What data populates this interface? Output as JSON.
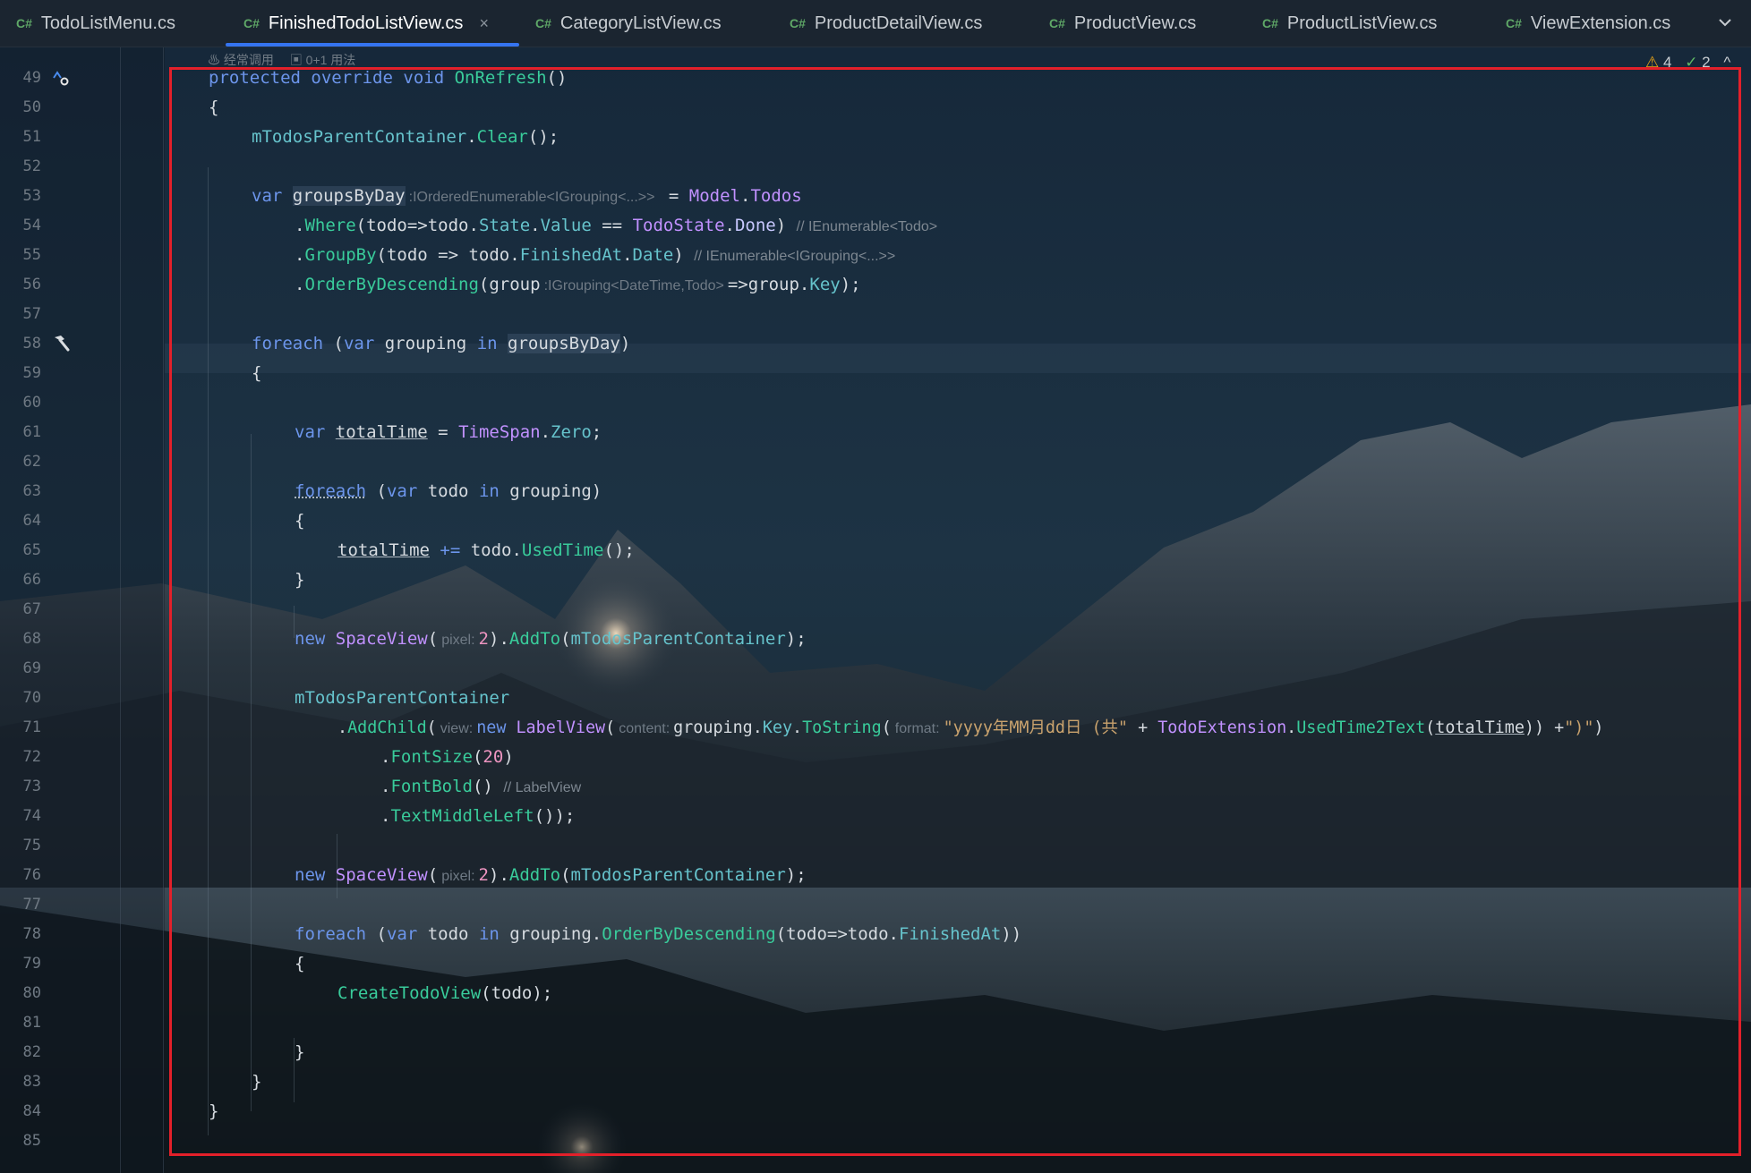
{
  "tabs": [
    {
      "icon": "csharp-file-icon",
      "lang": "C#",
      "label": "TodoListMenu.cs",
      "active": false
    },
    {
      "icon": "csharp-file-icon",
      "lang": "C#",
      "label": "FinishedTodoListView.cs",
      "active": true
    },
    {
      "icon": "csharp-file-icon",
      "lang": "C#",
      "label": "CategoryListView.cs",
      "active": false
    },
    {
      "icon": "csharp-file-icon",
      "lang": "C#",
      "label": "ProductDetailView.cs",
      "active": false
    },
    {
      "icon": "csharp-file-icon",
      "lang": "C#",
      "label": "ProductView.cs",
      "active": false
    },
    {
      "icon": "csharp-file-icon",
      "lang": "C#",
      "label": "ProductListView.cs",
      "active": false
    },
    {
      "icon": "csharp-file-icon",
      "lang": "C#",
      "label": "ViewExtension.cs",
      "active": false
    }
  ],
  "tab_close": "×",
  "inlay_usages": {
    "frequent": "经常调用",
    "usages": "0+1 用法"
  },
  "inspection": {
    "warnings": "4",
    "ok": "2"
  },
  "gutter": {
    "line_numbers": [
      "49",
      "50",
      "51",
      "52",
      "53",
      "54",
      "55",
      "56",
      "57",
      "58",
      "59",
      "60",
      "61",
      "62",
      "63",
      "64",
      "65",
      "66",
      "67",
      "68",
      "69",
      "70",
      "71",
      "72",
      "73",
      "74",
      "75",
      "76",
      "77",
      "78",
      "79",
      "80",
      "81",
      "82",
      "83",
      "84",
      "85"
    ]
  },
  "code": {
    "l49": {
      "protected": "protected",
      "override": "override",
      "void": "void",
      "name": "OnRefresh",
      "tail": "()"
    },
    "l50": "{",
    "l51": {
      "field": "mTodosParentContainer",
      "dot": ".",
      "method": "Clear",
      "tail": "();"
    },
    "l53": {
      "var": "var",
      "name": "groupsByDay",
      "hint": ":IOrderedEnumerable<IGrouping<...>>",
      "eq": " = ",
      "model": "Model",
      "dot": ".",
      "prop": "Todos"
    },
    "l54": {
      "dot": ".",
      "method": "Where",
      "p1": "(todo=>todo.",
      "state": "State",
      "dot2": ".",
      "value": "Value",
      "op": " == ",
      "type": "TodoState",
      "dot3": ".",
      "done": "Done",
      "close": ")",
      "comment": "// IEnumerable<Todo>"
    },
    "l55": {
      "dot": ".",
      "method": "GroupBy",
      "p1": "(todo => todo.",
      "fin": "FinishedAt",
      "dot2": ".",
      "date": "Date",
      "close": ")",
      "comment": "// IEnumerable<IGrouping<...>>"
    },
    "l56": {
      "dot": ".",
      "method": "OrderByDescending",
      "p1": "(group",
      "hint": ":IGrouping<DateTime,Todo>",
      "p2": "=>group.",
      "key": "Key",
      "tail": ");"
    },
    "l58": {
      "foreach": "foreach",
      "open": " (",
      "var": "var",
      "mid": " grouping ",
      "in": "in",
      "sp": " ",
      "coll": "groupsByDay",
      "close": ")"
    },
    "l59": "{",
    "l61": {
      "var": "var",
      "name": "totalTime",
      "eq": " = ",
      "type": "TimeSpan",
      "dot": ".",
      "zero": "Zero",
      "semi": ";"
    },
    "l63": {
      "foreach": "foreach",
      "open": " (",
      "var": "var",
      "mid": " todo ",
      "in": "in",
      "rest": " grouping)"
    },
    "l64": "{",
    "l65": {
      "name": "totalTime",
      "op": " += ",
      "obj": "todo.",
      "method": "UsedTime",
      "tail": "();"
    },
    "l66": "}",
    "l68": {
      "new": "new",
      "type": "SpaceView",
      "open": "(",
      "hint": "pixel:",
      "num": "2",
      "mid": ").",
      "method": "AddTo",
      "p": "(",
      "field": "mTodosParentContainer",
      "tail": ");"
    },
    "l70": {
      "field": "mTodosParentContainer"
    },
    "l71": {
      "dot": ".",
      "method": "AddChild",
      "open": "(",
      "hint_view": "view:",
      "new": "new",
      "type": "LabelView",
      "open2": "(",
      "hint_content": "content:",
      "grp": "grouping.",
      "key": "Key",
      "dot2": ".",
      "tostr": "ToString",
      "open3": "(",
      "hint_format": "format:",
      "str1": "\"yyyy年MM月dd日 (共\"",
      "plus": " + ",
      "ext": "TodoExtension",
      "dot3": ".",
      "used": "UsedTime2Text",
      "open4": "(",
      "total": "totalTime",
      "close4": ")) +",
      "str2": "\")\"",
      "close": ")"
    },
    "l72": {
      "dot": ".",
      "method": "FontSize",
      "open": "(",
      "num": "20",
      "close": ")"
    },
    "l73": {
      "dot": ".",
      "method": "FontBold",
      "tail": "()",
      "comment": "// LabelView"
    },
    "l74": {
      "dot": ".",
      "method": "TextMiddleLeft",
      "tail": "());"
    },
    "l76": {
      "new": "new",
      "type": "SpaceView",
      "open": "(",
      "hint": "pixel:",
      "num": "2",
      "mid": ").",
      "method": "AddTo",
      "p": "(",
      "field": "mTodosParentContainer",
      "tail": ");"
    },
    "l78": {
      "foreach": "foreach",
      "open": " (",
      "var": "var",
      "mid": " todo ",
      "in": "in",
      "grp": " grouping.",
      "method": "OrderByDescending",
      "p1": "(todo=>todo.",
      "fin": "FinishedAt",
      "tail": "))"
    },
    "l79": "{",
    "l80": {
      "method": "CreateTodoView",
      "tail": "(todo);"
    },
    "l82": "}",
    "l83": "}",
    "l84": "}"
  },
  "colors": {
    "selection_box": "#e3202a",
    "keyword": "#6c95eb",
    "method": "#39cc9b",
    "type": "#c191ff",
    "accent": "#3574f0"
  }
}
